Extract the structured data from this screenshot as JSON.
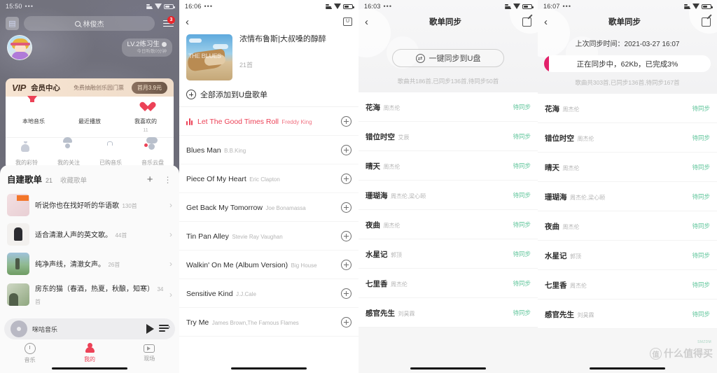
{
  "panel1": {
    "status": {
      "time": "15:50",
      "dots": "•••"
    },
    "search": {
      "value": "林俊杰",
      "icon": "search-icon"
    },
    "calendar_icon": "calendar-icon",
    "menu": {
      "icon": "hamburger-menu-icon",
      "badge": "3"
    },
    "profile": {
      "level": "LV.2练习生",
      "level_sub": "今日听歌0分钟"
    },
    "vip": {
      "word": "VIP",
      "title": "会员中心",
      "desc": "免费抽融创乐园门票",
      "button": "首月3.9元"
    },
    "grid_row1": [
      {
        "label": "本地音乐",
        "sub": "",
        "icon": "download-icon"
      },
      {
        "label": "最近播放",
        "sub": "",
        "icon": "clock-icon"
      },
      {
        "label": "我喜欢的",
        "sub": "11",
        "icon": "heart-icon"
      }
    ],
    "grid_row2": [
      {
        "label": "我的彩铃",
        "icon": "bell-icon"
      },
      {
        "label": "我的关注",
        "icon": "person-icon"
      },
      {
        "label": "已购音乐",
        "icon": "bag-icon"
      },
      {
        "label": "音乐云盘",
        "icon": "cloud-icon"
      }
    ],
    "playlist_header": {
      "title": "自建歌单",
      "count": "21",
      "tab2": "收藏歌单",
      "plus": "+",
      "more": "⋮"
    },
    "playlists": [
      {
        "name": "听说你也在找好听的华语歌",
        "sub": "130首"
      },
      {
        "name": "适合清澈人声的英文歌。",
        "sub": "44首"
      },
      {
        "name": "纯净声线，清澈女声。",
        "sub": "26首"
      },
      {
        "name": "房东的猫（春酒，热夏，秋酿，知寒）",
        "sub": "34首"
      }
    ],
    "mini_player": {
      "name": "咪咕音乐",
      "play_icon": "play-icon",
      "list_icon": "playlist-icon"
    },
    "tabs": [
      {
        "label": "音乐",
        "icon": "music-icon",
        "active": false
      },
      {
        "label": "我的",
        "icon": "person-icon",
        "active": true
      },
      {
        "label": "现场",
        "icon": "live-icon",
        "active": false
      }
    ]
  },
  "panel2": {
    "status": {
      "time": "16:06",
      "dots": "•••"
    },
    "nav": {
      "back_icon": "back-arrow-icon",
      "right_icon": "usb-card-icon"
    },
    "album": {
      "title": "浓情布鲁斯|大叔嗓的醇醉",
      "count": "21首",
      "cover_watermark": "THE BLUES"
    },
    "add_all": {
      "label": "全部添加到U盘歌单",
      "icon": "plus-circle-icon"
    },
    "songs": [
      {
        "title": "Let The Good Times Roll",
        "artist": "Freddy King",
        "playing": true
      },
      {
        "title": "Blues Man",
        "artist": "B.B.King",
        "playing": false
      },
      {
        "title": "Piece Of My Heart",
        "artist": "Eric Clapton",
        "playing": false
      },
      {
        "title": "Get Back My Tomorrow",
        "artist": "Joe Bonamassa",
        "playing": false
      },
      {
        "title": "Tin Pan Alley",
        "artist": "Stevie Ray Vaughan",
        "playing": false
      },
      {
        "title": "Walkin' On Me (Album Version)",
        "artist": "Big House",
        "playing": false
      },
      {
        "title": "Sensitive Kind",
        "artist": "J.J.Cale",
        "playing": false
      },
      {
        "title": "Try Me",
        "artist": "James Brown,The Famous Flames",
        "playing": false
      }
    ]
  },
  "panel3": {
    "status": {
      "time": "16:03",
      "dots": "•••"
    },
    "nav": {
      "title": "歌单同步",
      "back_icon": "back-arrow-icon",
      "right_icon": "edit-icon"
    },
    "sync_button": {
      "label": "一键同步到U盘",
      "icon": "sync-icon"
    },
    "stat": "歌曲共186首,已同步136首,待同步50首",
    "songs": [
      {
        "title": "花海",
        "artist": "周杰伦",
        "state": "待同步"
      },
      {
        "title": "错位时空",
        "artist": "艾辰",
        "state": "待同步"
      },
      {
        "title": "晴天",
        "artist": "周杰伦",
        "state": "待同步"
      },
      {
        "title": "珊瑚海",
        "artist": "周杰伦,梁心颐",
        "state": "待同步"
      },
      {
        "title": "夜曲",
        "artist": "周杰伦",
        "state": "待同步"
      },
      {
        "title": "水星记",
        "artist": "郭顶",
        "state": "待同步"
      },
      {
        "title": "七里香",
        "artist": "周杰伦",
        "state": "待同步"
      },
      {
        "title": "感官先生",
        "artist": "刘昊霖",
        "state": "待同步"
      }
    ]
  },
  "panel4": {
    "status": {
      "time": "16:07",
      "dots": "•••"
    },
    "nav": {
      "title": "歌单同步",
      "back_icon": "back-arrow-icon",
      "right_icon": "edit-icon"
    },
    "last_sync": "上次同步时间：2021-03-27 16:07",
    "progress": {
      "text": "正在同步中，62Kb，已完成3%",
      "percent": 3,
      "color": "#e2216a"
    },
    "stat": "歌曲共303首,已同步136首,待同步167首",
    "songs": [
      {
        "title": "花海",
        "artist": "周杰伦",
        "state": "待同步"
      },
      {
        "title": "错位时空",
        "artist": "周杰伦",
        "state": "待同步"
      },
      {
        "title": "晴天",
        "artist": "周杰伦",
        "state": "待同步"
      },
      {
        "title": "珊瑚海",
        "artist": "周杰伦,梁心颐",
        "state": "待同步"
      },
      {
        "title": "夜曲",
        "artist": "周杰伦",
        "state": "待同步"
      },
      {
        "title": "水星记",
        "artist": "郭顶",
        "state": "待同步"
      },
      {
        "title": "七里香",
        "artist": "周杰伦",
        "state": "待同步"
      },
      {
        "title": "感官先生",
        "artist": "刘昊霖",
        "state": "待同步"
      }
    ],
    "watermark": {
      "mark": "值",
      "text": "什么值得买",
      "tag": "SMZDM"
    }
  }
}
